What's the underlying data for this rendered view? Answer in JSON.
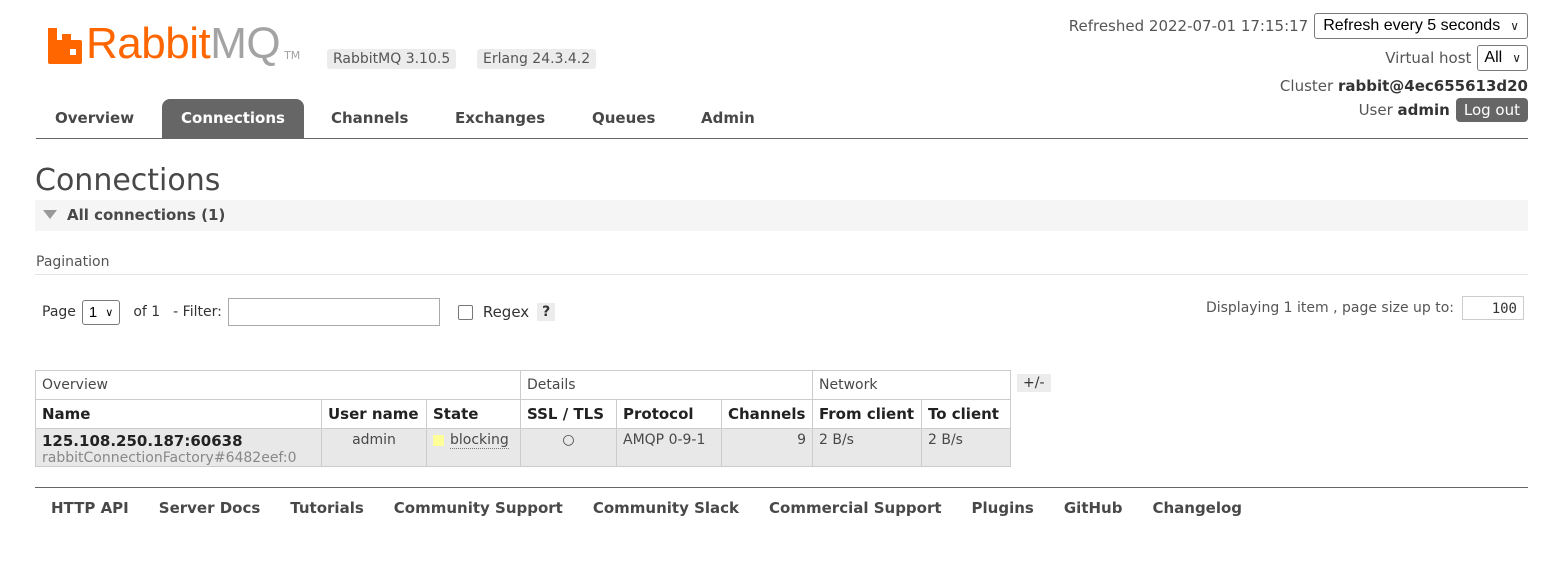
{
  "brand": {
    "name_a": "Rabbit",
    "name_b": "MQ",
    "tm": "TM"
  },
  "versions": {
    "rabbitmq": "RabbitMQ 3.10.5",
    "erlang": "Erlang 24.3.4.2"
  },
  "header": {
    "refreshed": "Refreshed 2022-07-01 17:15:17",
    "refresh_select": "Refresh every 5 seconds",
    "vhost_label": "Virtual host",
    "vhost_value": "All",
    "cluster_label": "Cluster",
    "cluster_name": "rabbit@4ec655613d20",
    "user_label": "User",
    "user_name": "admin",
    "logout": "Log out"
  },
  "nav": {
    "tabs": [
      "Overview",
      "Connections",
      "Channels",
      "Exchanges",
      "Queues",
      "Admin"
    ],
    "active": "Connections"
  },
  "page": {
    "title": "Connections",
    "section": "All connections (1)"
  },
  "pagination": {
    "label": "Pagination",
    "page_label": "Page",
    "page_value": "1",
    "of": "of 1",
    "filter_label": "- Filter:",
    "filter_value": "",
    "regex_label": "Regex",
    "help": "?",
    "displaying": "Displaying 1 item , page size up to:",
    "page_size": "100"
  },
  "table": {
    "groups": [
      "Overview",
      "Details",
      "Network"
    ],
    "columns": [
      "Name",
      "User name",
      "State",
      "SSL / TLS",
      "Protocol",
      "Channels",
      "From client",
      "To client"
    ],
    "toggle": "+/-",
    "rows": [
      {
        "name": "125.108.250.187:60638",
        "client": "rabbitConnectionFactory#6482eef:0",
        "user": "admin",
        "state": "blocking",
        "state_color": "#ffff99",
        "ssl": "○",
        "protocol": "AMQP 0-9-1",
        "channels": "9",
        "from_client": "2 B/s",
        "to_client": "2 B/s"
      }
    ]
  },
  "footer": {
    "links": [
      "HTTP API",
      "Server Docs",
      "Tutorials",
      "Community Support",
      "Community Slack",
      "Commercial Support",
      "Plugins",
      "GitHub",
      "Changelog"
    ]
  },
  "colors": {
    "brand_orange": "#ff6600",
    "nav_active": "#666666"
  }
}
